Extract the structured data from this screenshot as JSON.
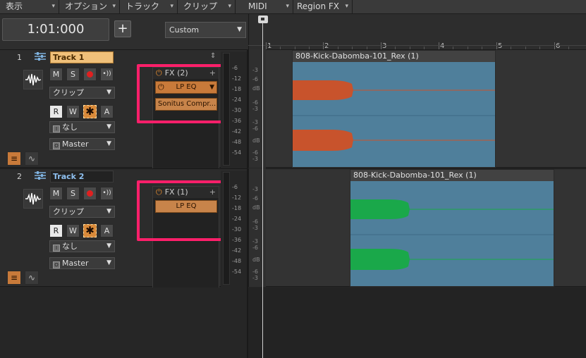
{
  "menubar": {
    "items": [
      {
        "label": "表示"
      },
      {
        "label": "オプション"
      },
      {
        "label": "トラック"
      },
      {
        "label": "クリップ"
      },
      {
        "label": "MIDI"
      },
      {
        "label": "Region FX"
      }
    ]
  },
  "toolbar": {
    "time": "1:01:000",
    "add_track_label": "+",
    "preset": "Custom"
  },
  "ruler": {
    "labels": [
      "1",
      "2",
      "3",
      "4",
      "5",
      "6"
    ]
  },
  "tracks": [
    {
      "number": "1",
      "name": "Track 1",
      "selected": true,
      "buttons": {
        "mute": "M",
        "solo": "S",
        "read": "R",
        "write": "W",
        "auto": "A"
      },
      "clip_dropdown": "クリップ",
      "input_dropdown": "なし",
      "output_dropdown": "Master",
      "fx": {
        "title": "FX (2)",
        "add": "+",
        "slots": [
          "LP EQ",
          "Sonitus Compr..."
        ]
      },
      "meter_labels": [
        "-6",
        "-12",
        "-18",
        "-24",
        "-30",
        "-36",
        "-42",
        "-48",
        "-54"
      ],
      "scale_labels": [
        "-3",
        "-6",
        "dB",
        "-6",
        "-3",
        "-3",
        "-6",
        "dB",
        "-6",
        "-3"
      ],
      "clip": {
        "title": "808-Kick-Dabomba-101_Rex (1)",
        "color": "#c8532c"
      }
    },
    {
      "number": "2",
      "name": "Track 2",
      "selected": false,
      "buttons": {
        "mute": "M",
        "solo": "S",
        "read": "R",
        "write": "W",
        "auto": "A"
      },
      "clip_dropdown": "クリップ",
      "input_dropdown": "なし",
      "output_dropdown": "Master",
      "fx": {
        "title": "FX (1)",
        "add": "+",
        "slots": [
          "LP EQ"
        ]
      },
      "meter_labels": [
        "-6",
        "-12",
        "-18",
        "-24",
        "-30",
        "-36",
        "-42",
        "-48",
        "-54"
      ],
      "scale_labels": [
        "-3",
        "-6",
        "dB",
        "-6",
        "-3",
        "-3",
        "-6",
        "dB",
        "-6",
        "-3"
      ],
      "clip": {
        "title": "808-Kick-Dabomba-101_Rex (1)",
        "color": "#1aa84a"
      }
    }
  ],
  "colors": {
    "accent_orange": "#c87a3a",
    "highlight": "#ff1f6a",
    "record": "#e02020"
  }
}
